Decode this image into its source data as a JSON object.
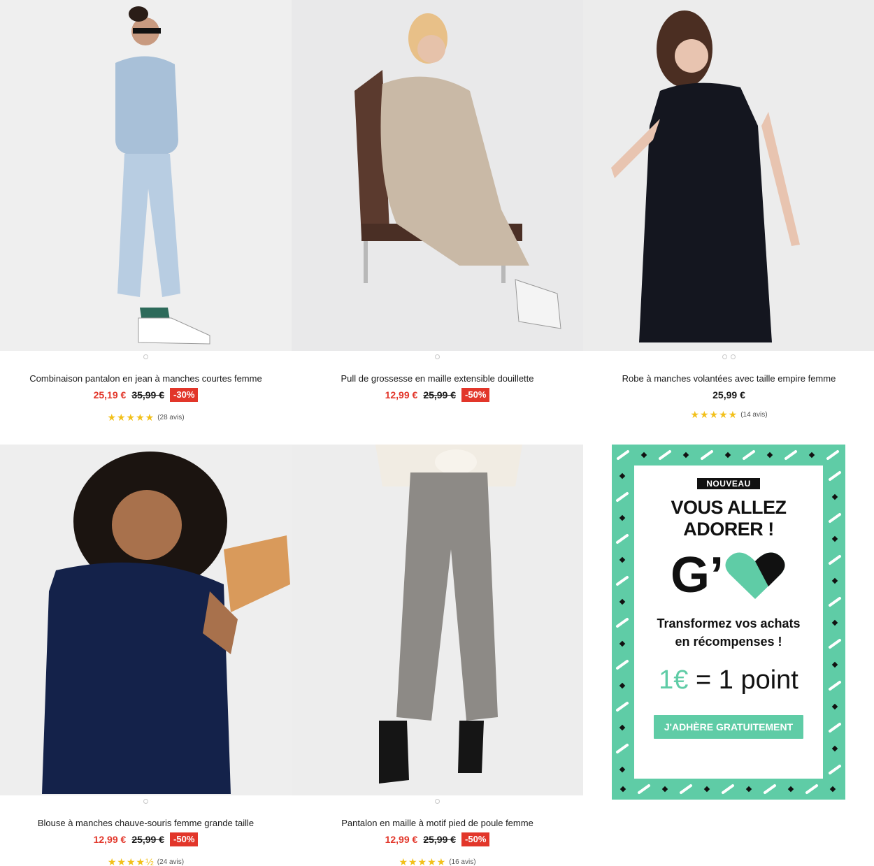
{
  "products": [
    {
      "name": "Combinaison pantalon en jean à manches courtes femme",
      "price": "25,19 €",
      "old_price": "35,99 €",
      "discount": "-30%",
      "stars": "★★★★★",
      "reviews": "(28 avis)"
    },
    {
      "name": "Pull de grossesse en maille extensible douillette",
      "price": "12,99 €",
      "old_price": "25,99 €",
      "discount": "-50%"
    },
    {
      "name": "Robe à manches volantées avec taille empire femme",
      "price": "25,99 €",
      "stars": "★★★★★",
      "reviews": "(14 avis)"
    },
    {
      "name": "Blouse à manches chauve-souris femme grande taille",
      "price": "12,99 €",
      "old_price": "25,99 €",
      "discount": "-50%",
      "stars": "★★★★½",
      "reviews": "(24 avis)"
    },
    {
      "name": "Pantalon en maille à motif pied de poule femme",
      "price": "12,99 €",
      "old_price": "25,99 €",
      "discount": "-50%",
      "stars": "★★★★★",
      "reviews": "(16 avis)"
    }
  ],
  "promo": {
    "tag": "NOUVEAU",
    "headline_1": "VOUS ALLEZ",
    "headline_2": "ADORER !",
    "logo_letter": "G’",
    "subtitle_1": "Transformez vos achats",
    "subtitle_2": "en récompenses !",
    "points_amount": "1€",
    "points_eq": "= 1 point",
    "cta": "J'ADHÈRE GRATUITEMENT"
  },
  "colors": {
    "accent": "#e2362a",
    "teal": "#5fcca6",
    "star": "#f2c01a"
  }
}
